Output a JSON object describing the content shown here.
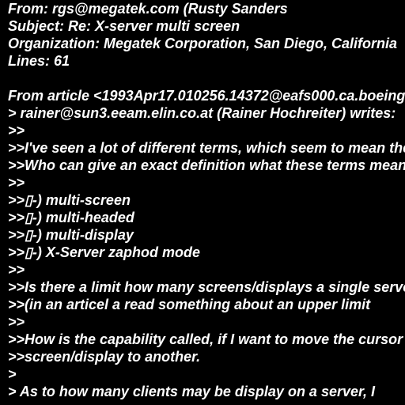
{
  "document": {
    "lines": [
      "From: rgs@megatek.com (Rusty Sanders",
      "Subject: Re: X-server multi screen",
      "Organization: Megatek Corporation, San Diego, California",
      "Lines: 61",
      "",
      "From article <1993Apr17.010256.14372@eafs000.ca.boeing.com>",
      "> rainer@sun3.eeam.elin.co.at (Rainer Hochreiter) writes:",
      ">>",
      ">>I've seen a lot of different terms, which seem to mean the same",
      ">>Who can give an exact definition what these terms mean",
      ">>",
      ">>▯-) multi-screen",
      ">>▯-) multi-headed",
      ">>▯-) multi-display",
      ">>▯-) X-Server zaphod mode",
      ">>",
      ">>Is there a limit how many screens/displays a single server",
      ">>(in an articel a read something about an upper limit",
      ">>",
      ">>How is the capability called, if I want to move the cursor",
      ">>screen/display to another.",
      ">",
      "> As to how many clients may be display on a server, I"
    ]
  }
}
